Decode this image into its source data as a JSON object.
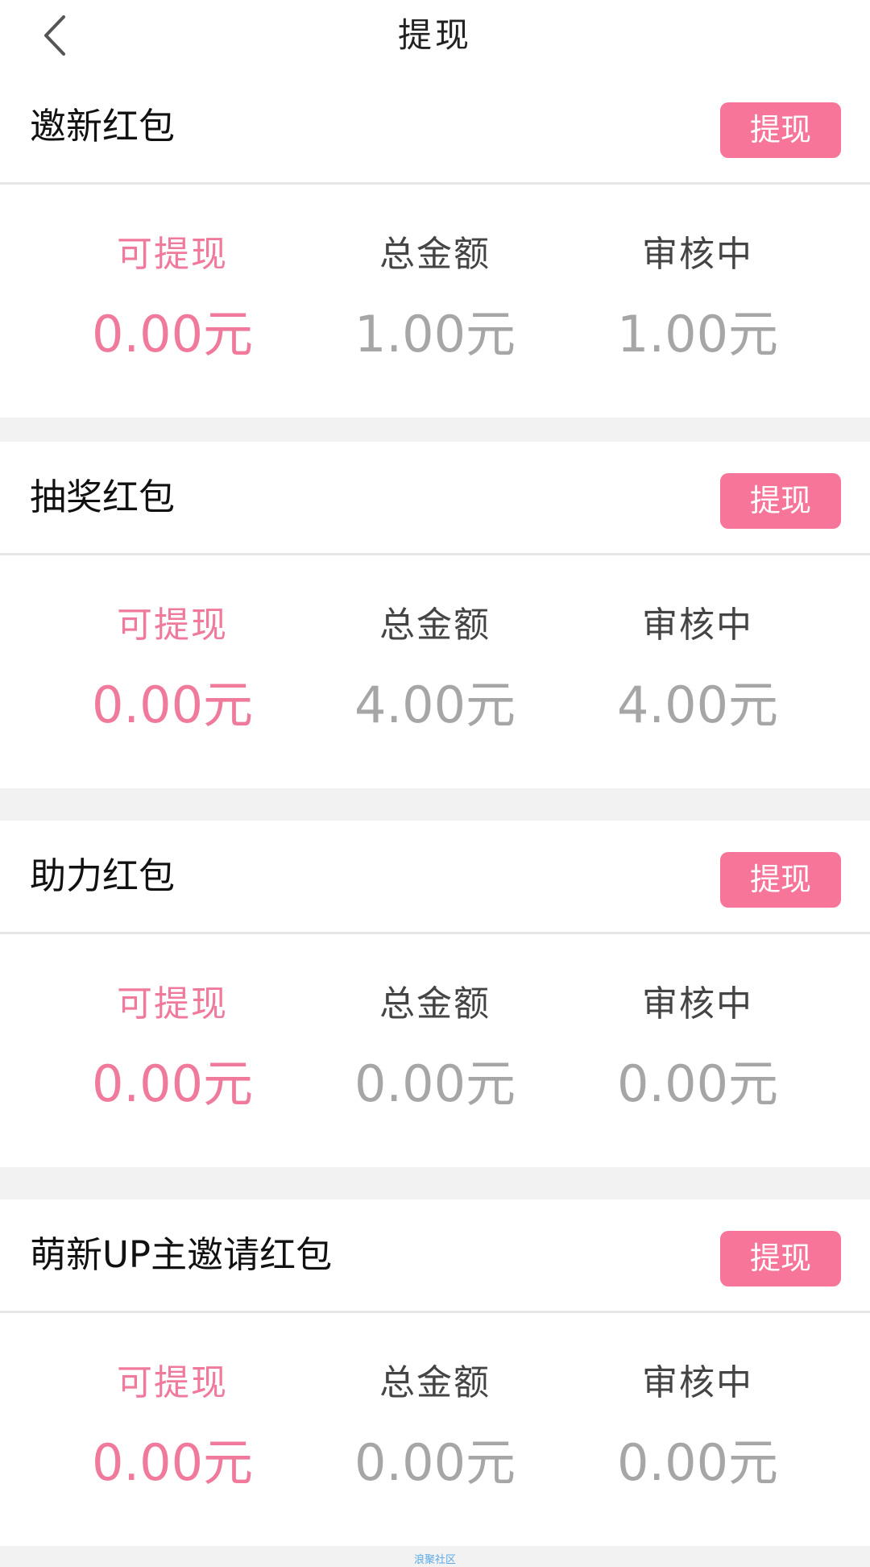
{
  "nav": {
    "title": "提现"
  },
  "cards": [
    {
      "title": "邀新红包",
      "button_label": "提现",
      "stats": [
        {
          "label": "可提现",
          "value": "0.00元"
        },
        {
          "label": "总金额",
          "value": "1.00元"
        },
        {
          "label": "审核中",
          "value": "1.00元"
        }
      ]
    },
    {
      "title": "抽奖红包",
      "button_label": "提现",
      "stats": [
        {
          "label": "可提现",
          "value": "0.00元"
        },
        {
          "label": "总金额",
          "value": "4.00元"
        },
        {
          "label": "审核中",
          "value": "4.00元"
        }
      ]
    },
    {
      "title": "助力红包",
      "button_label": "提现",
      "stats": [
        {
          "label": "可提现",
          "value": "0.00元"
        },
        {
          "label": "总金额",
          "value": "0.00元"
        },
        {
          "label": "审核中",
          "value": "0.00元"
        }
      ]
    },
    {
      "title": "萌新UP主邀请红包",
      "button_label": "提现",
      "stats": [
        {
          "label": "可提现",
          "value": "0.00元"
        },
        {
          "label": "总金额",
          "value": "0.00元"
        },
        {
          "label": "审核中",
          "value": "0.00元"
        }
      ]
    }
  ],
  "watermark": "浪聚社区",
  "colors": {
    "accent": "#f77598",
    "primary_text": "#ef7a9b",
    "muted_value": "#a6a6a6",
    "background": "#f2f2f2"
  },
  "icons": {
    "back": "chevron-left-icon"
  }
}
